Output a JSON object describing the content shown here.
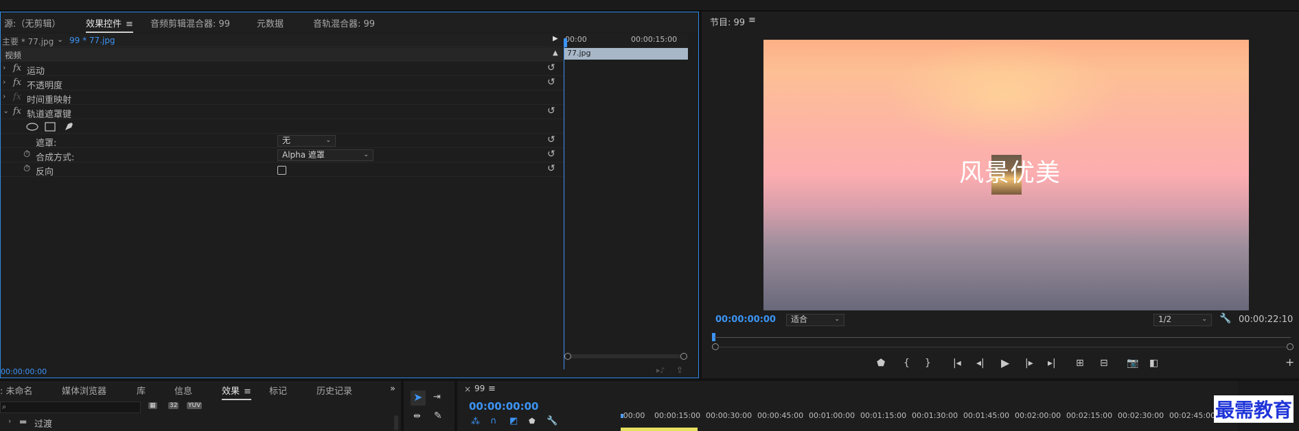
{
  "source_panel": {
    "tabs": [
      {
        "label": "源:（无剪辑）"
      },
      {
        "label": "效果控件"
      },
      {
        "label": "音频剪辑混合器: 99"
      },
      {
        "label": "元数据"
      },
      {
        "label": "音轨混合器: 99"
      }
    ],
    "menu_icon": "hamburger-icon",
    "clip_master": "主要 * 77.jpg",
    "clip_seq": "99 * 77.jpg",
    "time_start": "00:00",
    "time_mid": "00:00:15:00",
    "clip_bar": "77.jpg",
    "video_header": "视频",
    "effects": [
      {
        "name": "运动"
      },
      {
        "name": "不透明度"
      },
      {
        "name": "时间重映射"
      },
      {
        "name": "轨道遮罩键"
      }
    ],
    "mask_label": "遮罩:",
    "mask_value": "无",
    "composite_label": "合成方式:",
    "composite_value": "Alpha 遮罩",
    "reverse_label": "反向",
    "timecode": "00:00:00:00"
  },
  "program_monitor": {
    "title": "节目: 99",
    "overlay_text": "风景优美",
    "timecode": "00:00:00:00",
    "fit_value": "适合",
    "quality_value": "1/2",
    "duration": "00:00:22:10",
    "accent_color": "#3c94f4"
  },
  "project_panel": {
    "tabs": [
      {
        "label": ": 未命名"
      },
      {
        "label": "媒体浏览器"
      },
      {
        "label": "库"
      },
      {
        "label": "信息"
      },
      {
        "label": "效果"
      },
      {
        "label": "标记"
      },
      {
        "label": "历史记录"
      }
    ],
    "badges": [
      "32",
      "YUV"
    ],
    "folder_item": "过渡",
    "more_icon": "double-chevron-right-icon"
  },
  "timeline": {
    "close": "×",
    "sequence": "99",
    "timecode": "00:00:00:00",
    "ruler": [
      ":00:00",
      "00:00:15:00",
      "00:00:30:00",
      "00:00:45:00",
      "00:01:00:00",
      "00:01:15:00",
      "00:01:30:00",
      "00:01:45:00",
      "00:02:00:00",
      "00:02:15:00",
      "00:02:30:00",
      "00:02:45:00"
    ]
  },
  "watermark": "最需教育"
}
